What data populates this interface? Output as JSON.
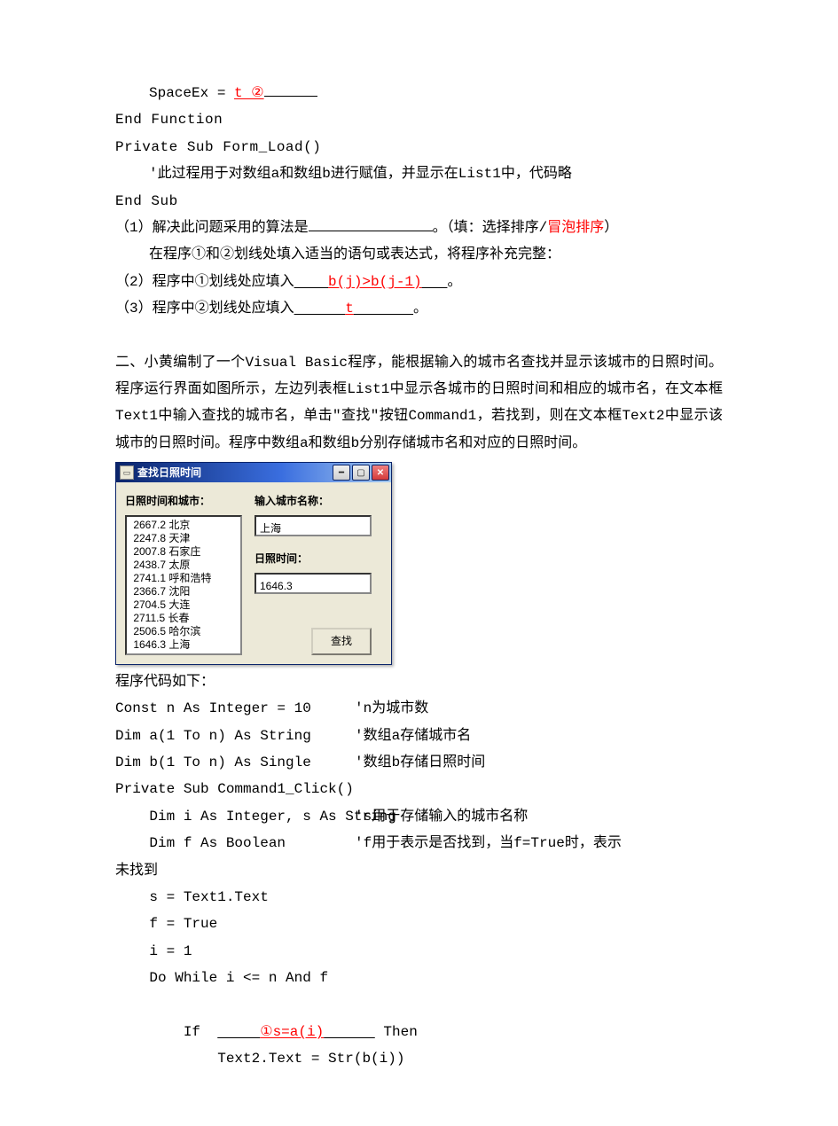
{
  "code_top": {
    "line1_prefix": "SpaceEx = ",
    "line1_answer_u": "t  ②",
    "line2": "End Function",
    "line3": "Private Sub Form_Load()",
    "line4": "'此过程用于对数组a和数组b进行赋值，并显示在List1中，代码略",
    "line5": "End Sub"
  },
  "q1": {
    "prefix": "（1）解决此问题采用的算法是",
    "middle": "。（填：选择排序/",
    "red": "冒泡排序",
    "suffix": "）",
    "line2": "在程序①和②划线处填入适当的语句或表达式，将程序补充完整："
  },
  "q2": {
    "prefix": "（2）程序中①划线处应填入",
    "answer": "b(j)>b(j-1)",
    "suffix": "。"
  },
  "q3": {
    "prefix": "（3）程序中②划线处应填入",
    "answer": "t",
    "suffix": "。"
  },
  "section2_intro": "二、小黄编制了一个Visual Basic程序，能根据输入的城市名查找并显示该城市的日照时间。程序运行界面如图所示，左边列表框List1中显示各城市的日照时间和相应的城市名，在文本框Text1中输入查找的城市名，单击\"查找\"按钮Command1，若找到，则在文本框Text2中显示该城市的日照时间。程序中数组a和数组b分别存储城市名和对应的日照时间。",
  "vbwin": {
    "title": "查找日照时间",
    "label_left": "日照时间和城市：",
    "label_input": "输入城市名称：",
    "input_value": "上海",
    "label_time": "日照时间：",
    "time_value": "1646.3",
    "button": "查找",
    "list_items": [
      " 2667.2 北京",
      " 2247.8 天津",
      " 2007.8 石家庄",
      " 2438.7 太原",
      " 2741.1 呼和浩特",
      " 2366.7 沈阳",
      " 2704.5 大连",
      " 2711.5 长春",
      " 2506.5 哈尔滨",
      " 1646.3 上海"
    ]
  },
  "code_bottom": {
    "label": "程序代码如下：",
    "r1l": "Const n As Integer = 10",
    "r1r": "'n为城市数",
    "r2l": "Dim a(1 To n) As String",
    "r2r": "'数组a存储城市名",
    "r3l": "Dim b(1 To n) As Single",
    "r3r": "'数组b存储日照时间",
    "r4": "Private Sub Command1_Click()",
    "r5l": "    Dim i As Integer, s As String",
    "r5r": "'s用于存储输入的城市名称",
    "r6l": "    Dim f As Boolean",
    "r6r": "'f用于表示是否找到，当f=True时，表示",
    "r7": "未找到",
    "r8": "    s = Text1.Text",
    "r9": "    f = True",
    "r10": "    i = 1",
    "r11": "    Do While i <= n And f",
    "r12_prefix": "        If  ",
    "r12_answer": "①s=a(i)",
    "r12_suffix": " Then",
    "r13": "            Text2.Text = Str(b(i))"
  }
}
